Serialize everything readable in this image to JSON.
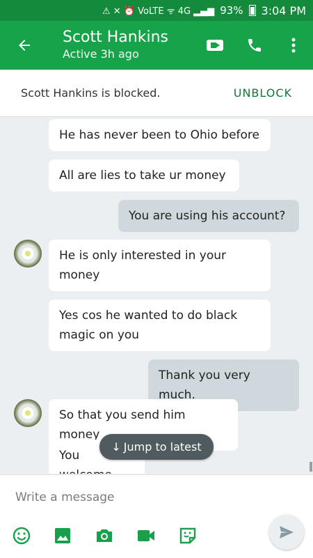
{
  "status_bar": {
    "icons_text": "⚠ ✕ ⏰ VoLTE ᯤ 4G ▂▄▆",
    "battery": "93%",
    "time": "3:04 PM"
  },
  "header": {
    "title": "Scott Hankins",
    "subtitle": "Active 3h ago",
    "icons": [
      "back-arrow-icon",
      "video-call-icon",
      "phone-icon",
      "more-vert-icon"
    ]
  },
  "banner": {
    "text": "Scott Hankins is blocked.",
    "action": "UNBLOCK"
  },
  "messages": [
    {
      "direction": "in",
      "text": "He has never been to Ohio before"
    },
    {
      "direction": "in",
      "text": "All are lies to take ur money"
    },
    {
      "direction": "out",
      "text": "You are using his account?"
    },
    {
      "direction": "in",
      "text": "He is only interested in your money"
    },
    {
      "direction": "in",
      "text": "Yes cos he wanted to do black magic on you"
    },
    {
      "direction": "out",
      "text": "Thank you very much."
    },
    {
      "direction": "in",
      "text": "So that you send him money"
    },
    {
      "direction": "in",
      "text": "You welcome"
    }
  ],
  "jump": {
    "label": "Jump to latest",
    "arrow": "↓"
  },
  "composer": {
    "placeholder": "Write a message",
    "tools": [
      "emoji-icon",
      "image-icon",
      "camera-icon",
      "video-icon",
      "sticker-icon",
      "send-icon"
    ]
  },
  "colors": {
    "status_bar": "#138a3c",
    "app_bar": "#17a34a",
    "unblock": "#0f7a37",
    "incoming_bubble": "#ffffff",
    "outgoing_bubble": "#cfd8dc",
    "background": "#eceff1"
  }
}
